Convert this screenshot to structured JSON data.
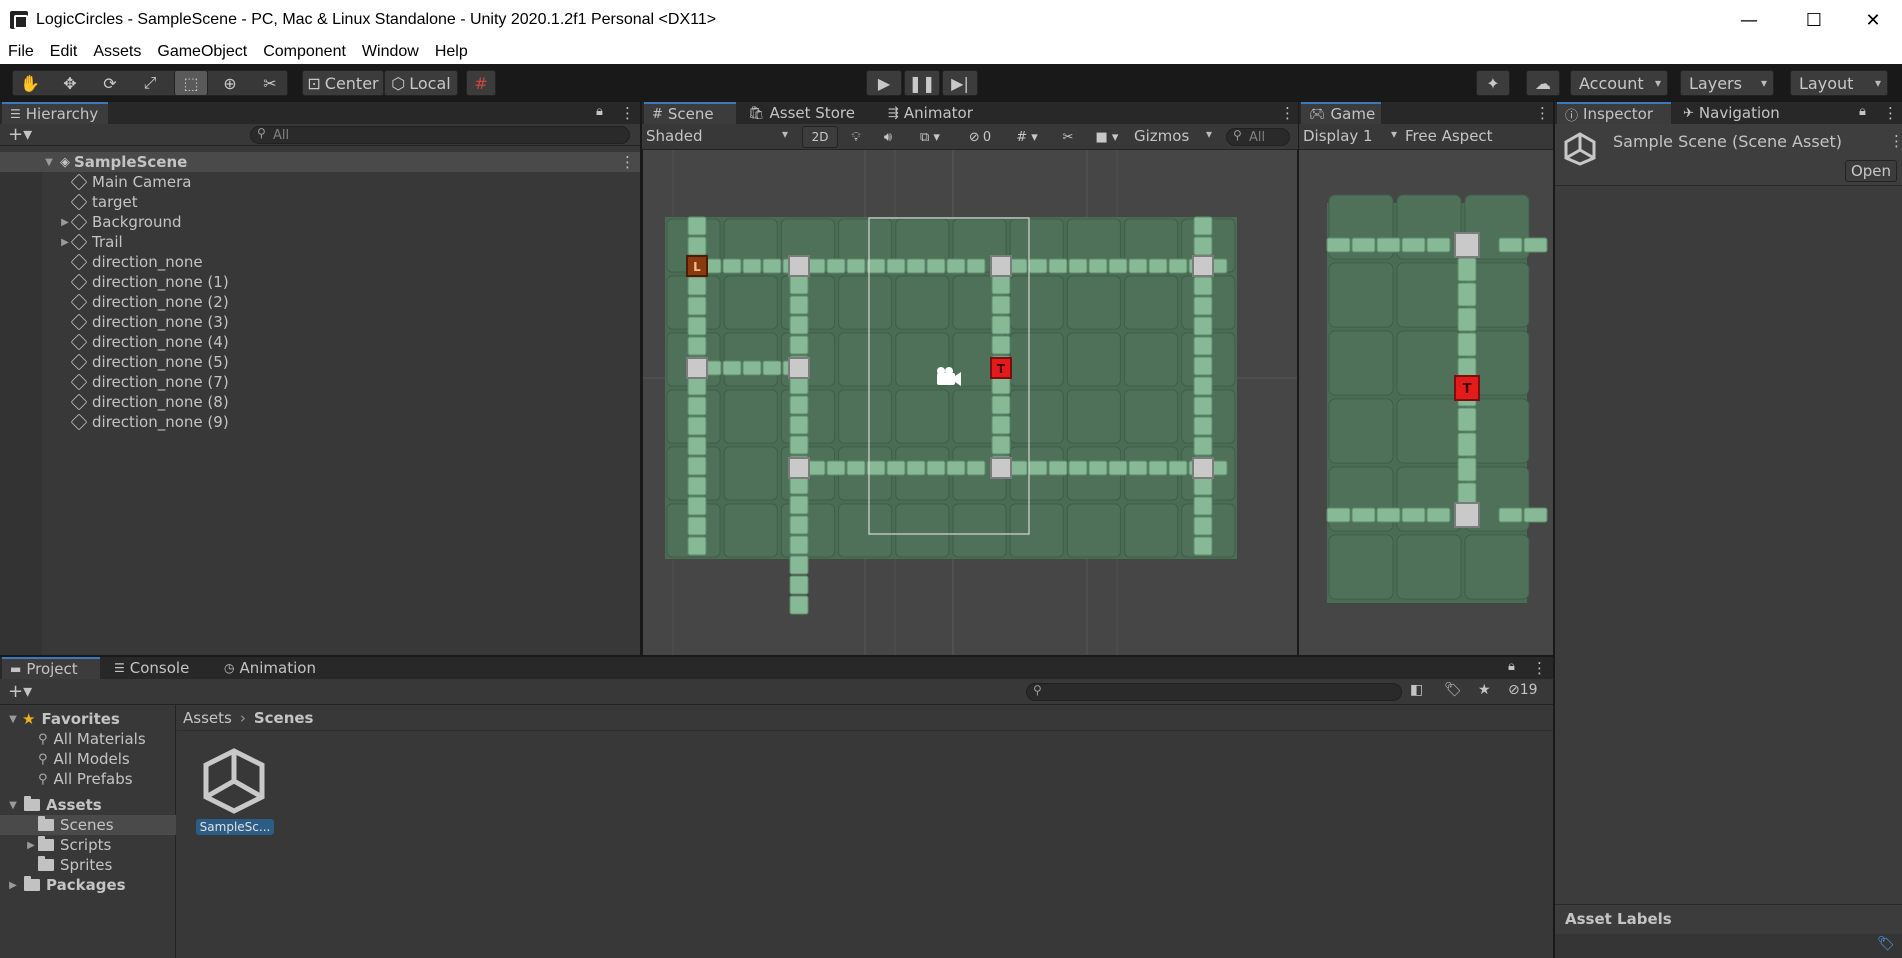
{
  "window": {
    "title": "LogicCircles - SampleScene - PC, Mac & Linux Standalone - Unity 2020.1.2f1 Personal <DX11>",
    "minimize": "—",
    "maximize": "☐",
    "close": "✕"
  },
  "menu": [
    "File",
    "Edit",
    "Assets",
    "GameObject",
    "Component",
    "Window",
    "Help"
  ],
  "toolbar": {
    "pivot_label": "Center",
    "space_label": "Local",
    "account_label": "Account",
    "layers_label": "Layers",
    "layout_label": "Layout"
  },
  "hierarchy": {
    "tab": "Hierarchy",
    "search_placeholder": "All",
    "scene_name": "SampleScene",
    "items": [
      {
        "label": "Main Camera",
        "expandable": false
      },
      {
        "label": "target",
        "expandable": false
      },
      {
        "label": "Background",
        "expandable": true
      },
      {
        "label": "Trail",
        "expandable": true
      },
      {
        "label": "direction_none",
        "expandable": false
      },
      {
        "label": "direction_none (1)",
        "expandable": false
      },
      {
        "label": "direction_none (2)",
        "expandable": false
      },
      {
        "label": "direction_none (3)",
        "expandable": false
      },
      {
        "label": "direction_none (4)",
        "expandable": false
      },
      {
        "label": "direction_none (5)",
        "expandable": false
      },
      {
        "label": "direction_none (7)",
        "expandable": false
      },
      {
        "label": "direction_none (8)",
        "expandable": false
      },
      {
        "label": "direction_none (9)",
        "expandable": false
      }
    ]
  },
  "scene": {
    "tabs": [
      "Scene",
      "Asset Store",
      "Animator"
    ],
    "shading": "Shaded",
    "mode_2d": "2D",
    "hidden_count": "0",
    "gizmos": "Gizmos",
    "search_placeholder": "All",
    "left_marker": "L",
    "red_marker": "T"
  },
  "game": {
    "tab": "Game",
    "display": "Display 1",
    "aspect": "Free Aspect",
    "red_marker": "T"
  },
  "inspector": {
    "tabs": [
      "Inspector",
      "Navigation"
    ],
    "asset_title": "Sample Scene (Scene Asset)",
    "open_button": "Open",
    "asset_labels": "Asset Labels"
  },
  "project": {
    "tabs": [
      "Project",
      "Console",
      "Animation"
    ],
    "hidden_count": "19",
    "favorites_label": "Favorites",
    "favorites": [
      "All Materials",
      "All Models",
      "All Prefabs"
    ],
    "assets_label": "Assets",
    "asset_folders": [
      {
        "label": "Scenes",
        "expandable": false,
        "selected": true
      },
      {
        "label": "Scripts",
        "expandable": true,
        "selected": false
      },
      {
        "label": "Sprites",
        "expandable": false,
        "selected": false
      }
    ],
    "packages_label": "Packages",
    "breadcrumb": [
      "Assets",
      "Scenes"
    ],
    "files": [
      {
        "label": "SampleSc..."
      }
    ]
  },
  "colors": {
    "accent": "#3a79bb",
    "panel": "#383838",
    "tab_bar": "#282828",
    "field_green": "#4b6b55",
    "path_chip": "#86b896",
    "target_red": "#e31b1b"
  }
}
